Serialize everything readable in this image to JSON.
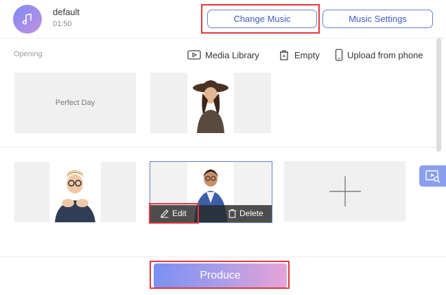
{
  "header": {
    "music_icon": "music-note-icon",
    "title": "default",
    "duration": "01:50",
    "change_music_label": "Change Music",
    "music_settings_label": "Music Settings"
  },
  "toolbar": {
    "section_label": "Opening",
    "media_library_label": "Media Library",
    "empty_label": "Empty",
    "upload_label": "Upload from phone"
  },
  "slots": {
    "title_card_text": "Perfect Day"
  },
  "selected_slot": {
    "edit_label": "Edit",
    "delete_label": "Delete"
  },
  "footer": {
    "produce_label": "Produce"
  },
  "colors": {
    "accent": "#5b7fd6",
    "highlight": "#e4343a",
    "produce_gradient_start": "#7a90f3",
    "produce_gradient_end": "#e7a3d6",
    "side_tab": "#8aa0ee"
  }
}
